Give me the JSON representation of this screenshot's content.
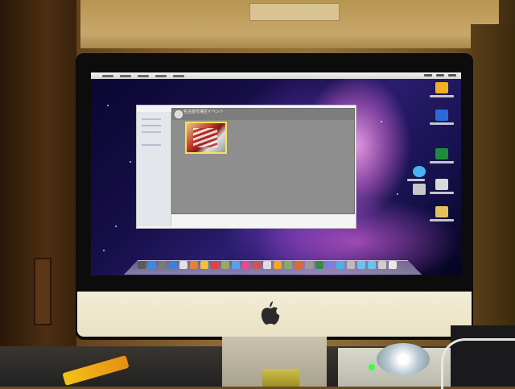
{
  "scene": {
    "description_subject": "iMac",
    "colors": {
      "wall": "#8a6630",
      "bezel": "#0c0c0c",
      "chin": "#f3edd6",
      "window_gray": "#8e8e8e",
      "photo_border": "#f6e25a"
    }
  },
  "screen": {
    "apple_menu_glyph": "",
    "event_window_title": "名古屋市港区イベント",
    "desktop_icon_count": 7,
    "dock_icon_count": 27
  },
  "icons": {
    "apple": "apple-logo",
    "stand": "imac-stand"
  }
}
